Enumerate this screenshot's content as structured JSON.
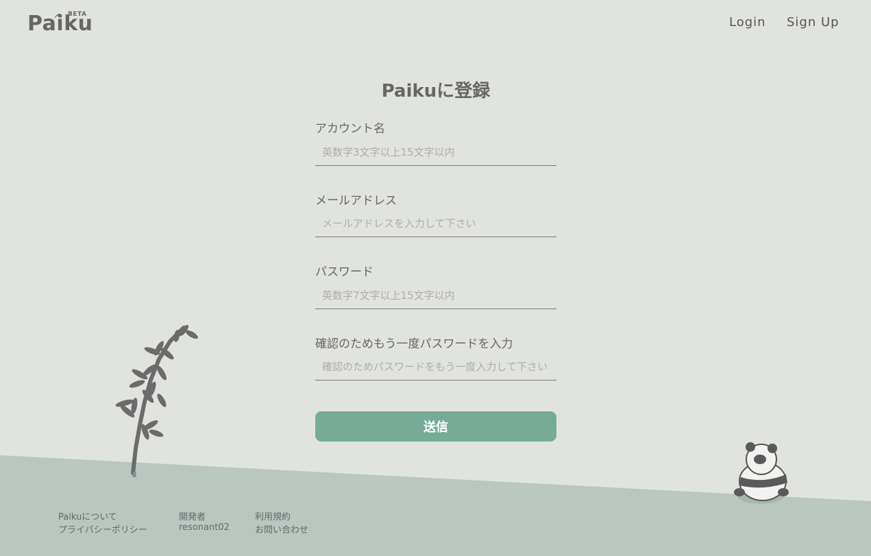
{
  "header": {
    "logo_text": "Paiku",
    "logo_badge": "BETA",
    "nav": {
      "login": "Login",
      "signup": "Sign Up"
    }
  },
  "form": {
    "title": "Paikuに登録",
    "account": {
      "label": "アカウント名",
      "placeholder": "英数字3文字以上15文字以内"
    },
    "email": {
      "label": "メールアドレス",
      "placeholder": "メールアドレスを入力して下さい"
    },
    "password": {
      "label": "パスワード",
      "placeholder": "英数字7文字以上15文字以内"
    },
    "confirm": {
      "label": "確認のためもう一度パスワードを入力",
      "placeholder": "確認のためパスワードをもう一度入力して下さい"
    },
    "submit_label": "送信"
  },
  "footer": {
    "about": "Paikuについて",
    "privacy": "プライバシーポリシー",
    "developer_label": "開発者",
    "developer_name": "resonant02",
    "terms": "利用規約",
    "contact": "お問い合わせ"
  },
  "colors": {
    "background": "#e1e3df",
    "ground": "#bac7c0",
    "accent": "#76ac97",
    "text": "#666666"
  },
  "icons": [
    "bamboo-leaf-icon",
    "bamboo-illustration",
    "panda-illustration"
  ]
}
